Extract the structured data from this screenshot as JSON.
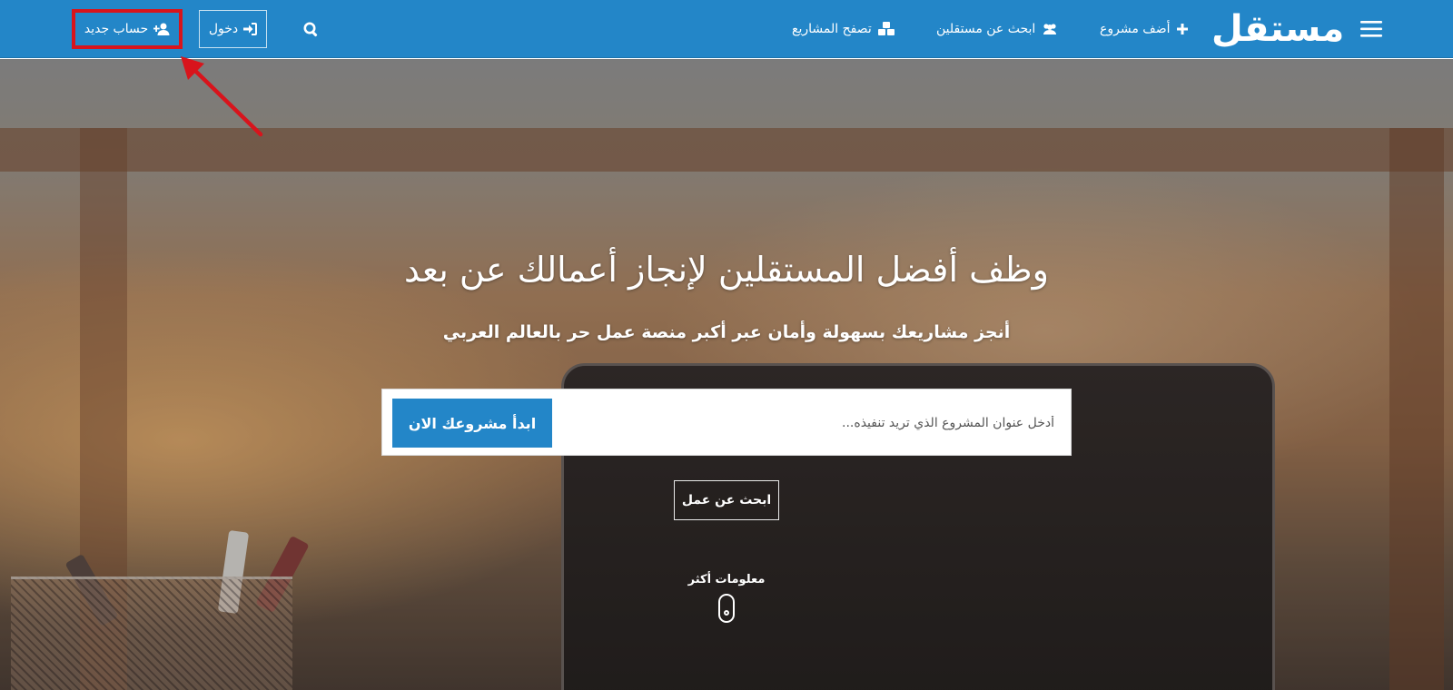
{
  "brand": {
    "logo_text": "مستقل"
  },
  "navbar": {
    "add_project": "أضف مشروع",
    "find_freelancers": "ابحث عن مستقلين",
    "browse_projects": "تصفح المشاريع",
    "login": "دخول",
    "signup": "حساب جديد"
  },
  "icons": {
    "menu": "hamburger-menu-icon",
    "add": "plus-icon",
    "freelancers": "users-icon",
    "browse": "cubes-icon",
    "search": "search-icon",
    "login": "sign-in-icon",
    "signup": "user-plus-icon",
    "scroll": "mouse-icon"
  },
  "hero": {
    "title": "وظف أفضل المستقلين لإنجاز أعمالك عن بعد",
    "subtitle": "أنجز مشاريعك بسهولة وأمان عبر أكبر منصة عمل حر بالعالم العربي",
    "search_placeholder": "أدخل عنوان المشروع الذي تريد تنفيذه...",
    "start_button": "ابدأ مشروعك الان",
    "find_work_button": "ابحث عن عمل",
    "more_info": "معلومات أكثر"
  },
  "colors": {
    "primary": "#2386c8",
    "annotation": "#d8141c"
  }
}
